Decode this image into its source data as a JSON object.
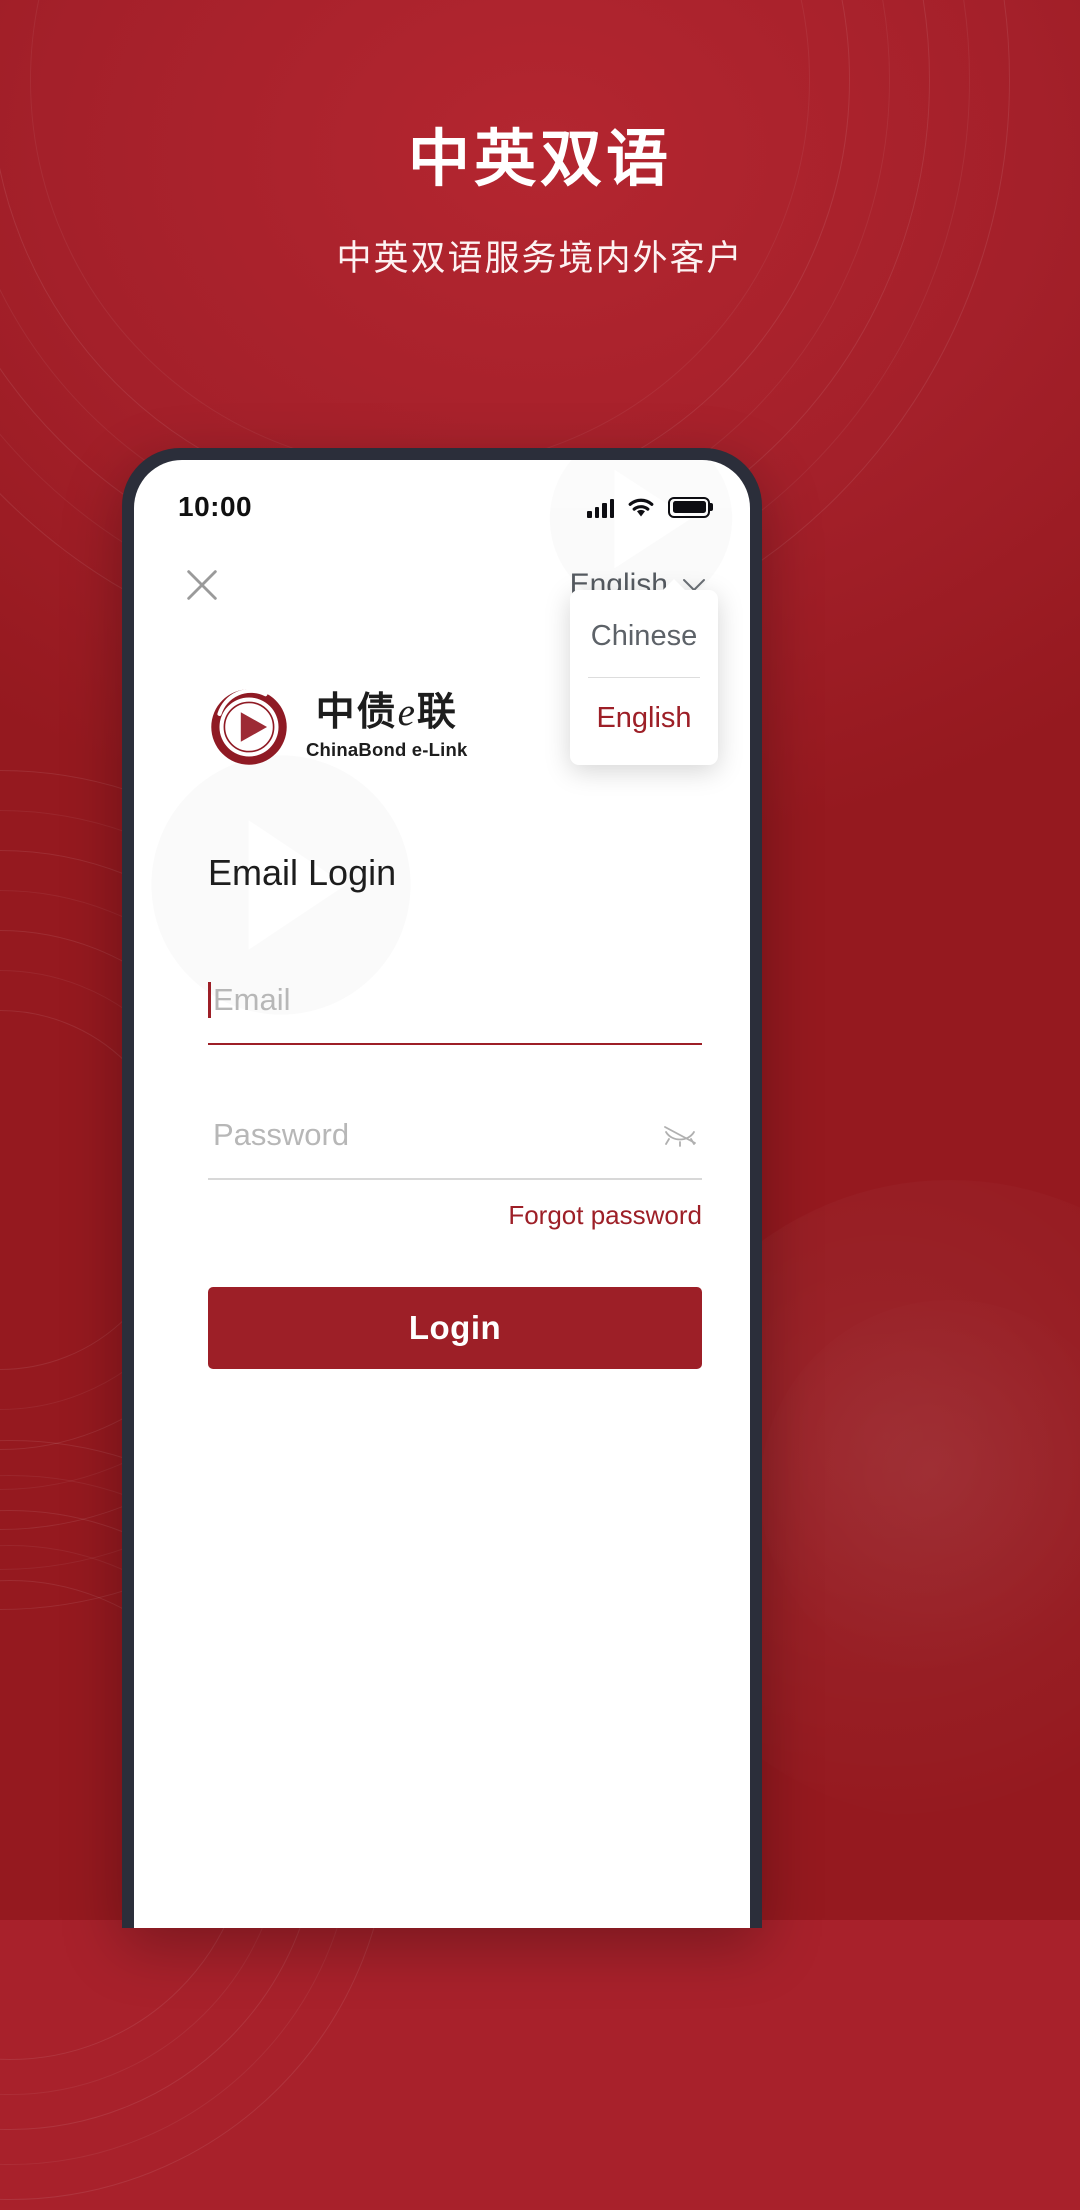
{
  "promo": {
    "title": "中英双语",
    "subtitle": "中英双语服务境内外客户"
  },
  "phone": {
    "statusbar": {
      "time": "10:00",
      "signal_icon": "signal-bars-icon",
      "wifi_icon": "wifi-icon",
      "battery_icon": "battery-icon"
    },
    "nav": {
      "close_icon": "close-icon",
      "language_label": "English",
      "chevron_icon": "chevron-down-icon"
    },
    "language_menu": {
      "options": [
        {
          "label": "Chinese",
          "selected": false
        },
        {
          "label": "English",
          "selected": true
        }
      ]
    },
    "logo": {
      "mark_icon": "play-circle-logo-icon",
      "name_cn": "中债",
      "name_cn_e": "e",
      "name_cn_tail": "联",
      "name_en": "ChinaBond e-Link"
    },
    "form": {
      "title": "Email Login",
      "email_placeholder": "Email",
      "email_value": "",
      "password_placeholder": "Password",
      "password_value": "",
      "eye_icon": "eye-off-icon",
      "forgot_password": "Forgot password",
      "login_button": "Login"
    }
  },
  "colors": {
    "brand_red": "#9d1f27",
    "background_red": "#a8212b",
    "placeholder_gray": "#b7b7b7"
  }
}
